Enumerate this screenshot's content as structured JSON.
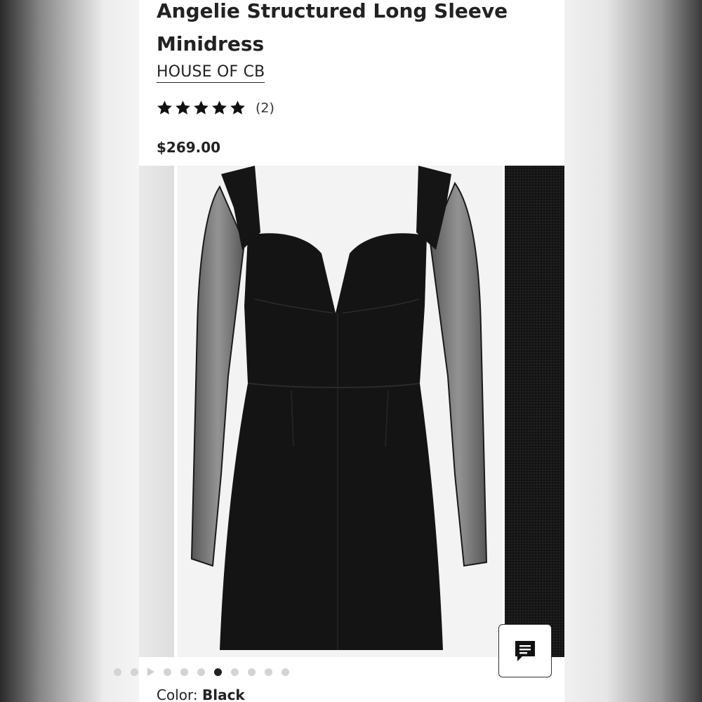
{
  "product": {
    "title": "Angelie Structured Long Sleeve Minidress",
    "brand": "HOUSE OF CB",
    "rating": {
      "stars": 5,
      "review_count": "(2)"
    },
    "price": "$269.00",
    "color_label": "Color:",
    "color_value": "Black"
  },
  "gallery": {
    "slide_count": 11,
    "active_index": 6,
    "video_index": 2
  },
  "colors": {
    "text": "#222222",
    "dress": "#141414",
    "background": "#ffffff"
  },
  "icons": {
    "star": "star-icon",
    "chat": "chat-icon",
    "play": "play-icon"
  }
}
